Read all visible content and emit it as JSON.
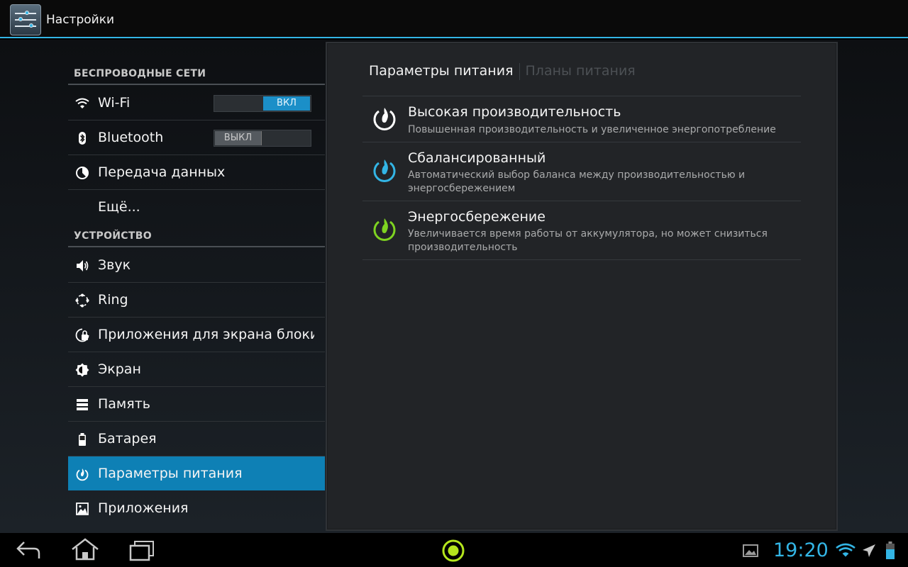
{
  "action_bar": {
    "title": "Настройки"
  },
  "sidebar": {
    "sections": [
      {
        "header": "БЕСПРОВОДНЫЕ СЕТИ"
      },
      {
        "header": "УСТРОЙСТВО"
      }
    ],
    "items": [
      {
        "label": "Wi-Fi",
        "icon": "wifi-icon",
        "toggle": "ВКЛ"
      },
      {
        "label": "Bluetooth",
        "icon": "bluetooth-icon",
        "toggle": "ВЫКЛ"
      },
      {
        "label": "Передача данных",
        "icon": "data-usage-icon"
      },
      {
        "label": "Ещё...",
        "icon": ""
      },
      {
        "label": "Звук",
        "icon": "speaker-icon"
      },
      {
        "label": "Ring",
        "icon": "ring-icon"
      },
      {
        "label": "Приложения для экрана блокировки",
        "icon": "lock-screen-icon"
      },
      {
        "label": "Экран",
        "icon": "display-icon"
      },
      {
        "label": "Память",
        "icon": "storage-icon"
      },
      {
        "label": "Батарея",
        "icon": "battery-icon"
      },
      {
        "label": "Параметры питания",
        "icon": "power-icon",
        "selected": true
      },
      {
        "label": "Приложения",
        "icon": "apps-icon"
      }
    ]
  },
  "pane": {
    "tabs": [
      {
        "label": "Параметры питания",
        "selected": true
      },
      {
        "label": "Планы питания",
        "selected": false
      }
    ],
    "plans": [
      {
        "title": "Высокая производительность",
        "subtitle": "Повышенная производительность и увеличенное энергопотребление",
        "color": "#ffffff",
        "icon": "high-performance-icon"
      },
      {
        "title": "Сбалансированный",
        "subtitle": "Автоматический выбор баланса между производительностью и энергосбережением",
        "color": "#33b5e5",
        "icon": "balanced-icon"
      },
      {
        "title": "Энергосбережение",
        "subtitle": "Увеличивается время работы от аккумулятора, но может снизиться производительность",
        "color": "#7ed321",
        "icon": "power-saving-icon"
      }
    ]
  },
  "status_bar": {
    "time": "19:20"
  },
  "colors": {
    "accent": "#33b5e5",
    "selected_bg": "#0e80b5",
    "green": "#b5e61d"
  }
}
